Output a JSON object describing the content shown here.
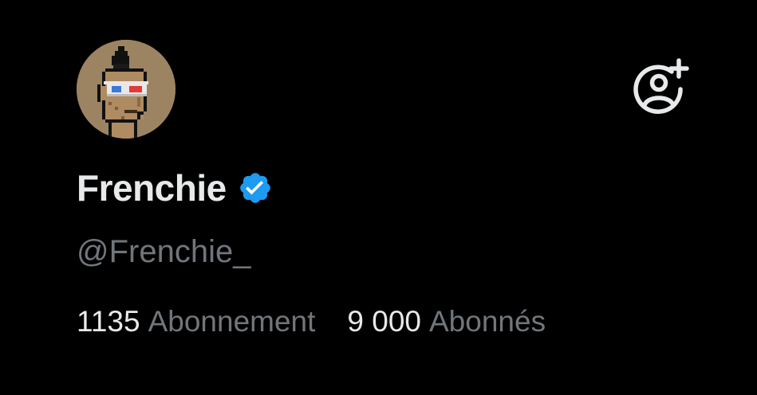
{
  "profile": {
    "display_name": "Frenchie",
    "handle": "@Frenchie_",
    "verified": true,
    "avatar_icon": "pixel-punk-avatar"
  },
  "stats": {
    "following_count": "1135",
    "following_label": "Abonnement",
    "followers_count": "9 000",
    "followers_label": "Abonnés"
  },
  "actions": {
    "follow_icon": "person-add-icon"
  },
  "colors": {
    "background": "#000000",
    "primary_text": "#e7e9ea",
    "secondary_text": "#71767b",
    "verified_badge": "#1d9bf0",
    "avatar_background": "#9c8462"
  }
}
